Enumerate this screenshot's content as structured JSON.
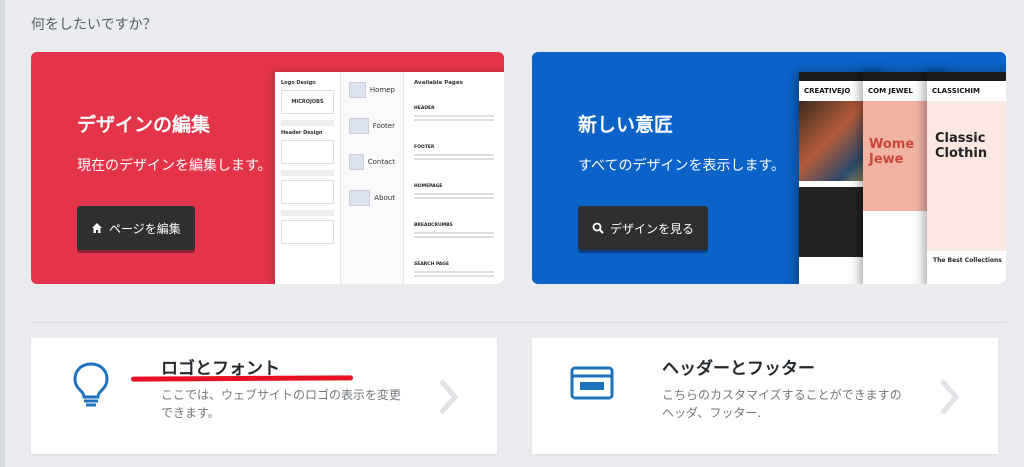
{
  "heading": "何をしたいですか？",
  "cards_top": [
    {
      "title": "デザインの編集",
      "description": "現在のデザインを編集します。",
      "button_label": "ページを編集",
      "button_icon": "home-icon",
      "color": "#e4344a",
      "preview": {
        "col1_title": "Logo Design",
        "col1_logo": "MICROJOBS",
        "col1_sub": "Header Design",
        "col2_items": [
          "Homep",
          "Footer",
          "Contact",
          "About"
        ],
        "col3_title": "Available Pages",
        "col3_rows": [
          "HEADER",
          "FOOTER",
          "HOMEPAGE",
          "BREADCRUMBS",
          "SEARCH PAGE"
        ]
      }
    },
    {
      "title": "新しい意匠",
      "description": "すべてのデザインを表示します。",
      "button_label": "デザインを見る",
      "button_icon": "search-icon",
      "color": "#0b63c9",
      "preview": {
        "t1_logo": "CREATIVEJO",
        "t2_logo": "COM JEWEL",
        "t2_headline": "Wome Jewe",
        "t3_logo": "CLASSICHIM",
        "t3_headline": "Classic Clothin",
        "t3_caption": "The Best Collections"
      }
    }
  ],
  "cards_bottom": [
    {
      "title": "ロゴとフォント",
      "description": "ここでは、ウェブサイトのロゴの表示を変更できます。",
      "icon": "lightbulb-icon"
    },
    {
      "title": "ヘッダーとフッター",
      "description": "こちらのカスタマイズすることができますのヘッダ、フッター.",
      "icon": "header-footer-icon"
    }
  ],
  "colors": {
    "accent_red": "#e4344a",
    "accent_blue": "#0b63c9",
    "icon_blue": "#1e73be",
    "annotation_red": "#e81123"
  }
}
